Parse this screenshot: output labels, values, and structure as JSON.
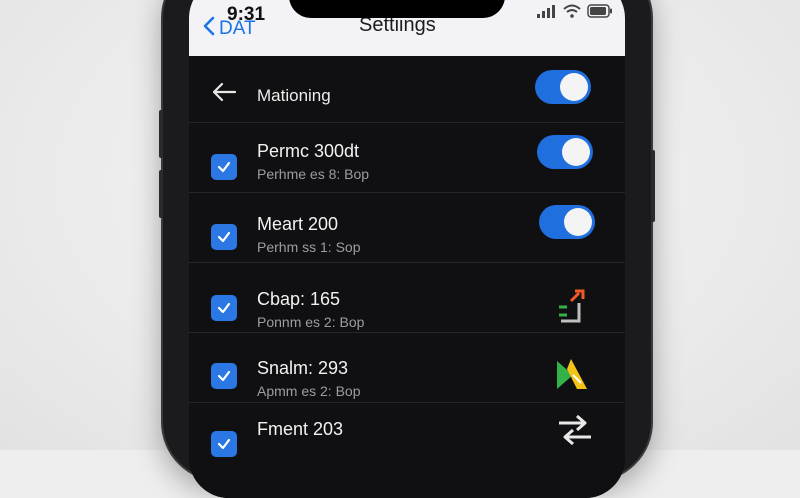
{
  "status_bar": {
    "time": "9:31"
  },
  "nav": {
    "back_label": "DAT",
    "title": "Settiings"
  },
  "header": {
    "label": "Mationing",
    "toggle_on": true
  },
  "rows": [
    {
      "title": "Permc 300dt",
      "subtitle": "Perhme es 8: Bop",
      "checked": true,
      "trailing": "toggle-on"
    },
    {
      "title": "Meart 200",
      "subtitle": "Perhm ss 1: Sop",
      "checked": true,
      "trailing": "toggle-on"
    },
    {
      "title": "Cbap: 165",
      "subtitle": "Ponnm es 2: Bop",
      "checked": true,
      "trailing": "arrow-icon"
    },
    {
      "title": "Snalm: 293",
      "subtitle": "Apmm es 2: Bop",
      "checked": true,
      "trailing": "direction-icon"
    },
    {
      "title": "Fment 203",
      "subtitle": "",
      "checked": true,
      "trailing": "swap-icon"
    }
  ],
  "colors": {
    "accent": "#1f6fde",
    "list_background": "#101012",
    "nav_background": "#f2f2f7"
  }
}
